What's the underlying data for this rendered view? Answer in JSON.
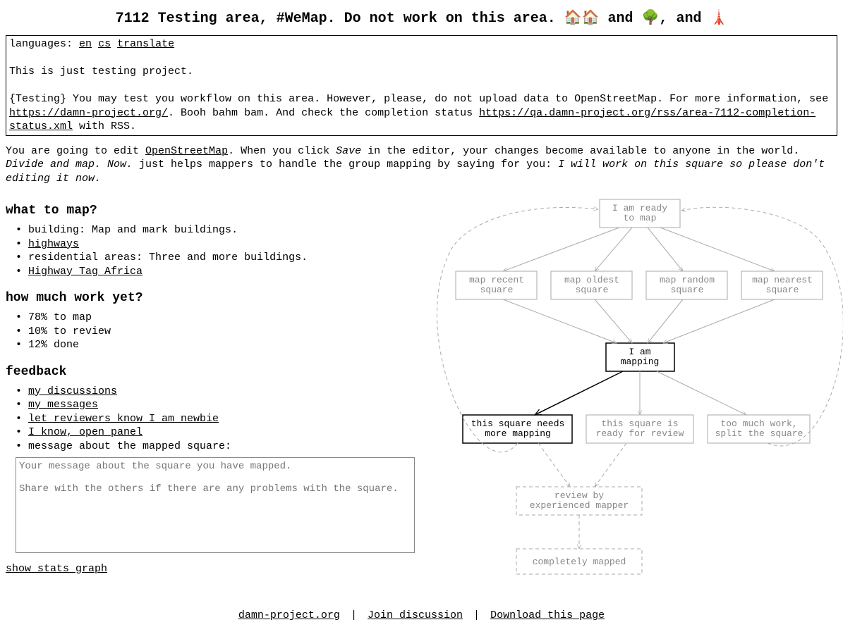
{
  "title": "7112 Testing area, #WeMap. Do not work on this area. 🏠🏠 and 🌳, and 🗼",
  "languages_label": "languages:",
  "languages": {
    "en": "en",
    "cs": "cs",
    "translate": "translate"
  },
  "desc": {
    "intro": "This is just testing project.",
    "body1a": "{Testing} You may test you workflow on this area. However, please, do not upload data to OpenStreetMap. For more information, see ",
    "link1": "https://damn-project.org/",
    "body1b": ". Booh bahm bam. And check the completion status ",
    "link2": "https://qa.damn-project.org/rss/area-7112-completion-status.xml",
    "body1c": " with RSS."
  },
  "intro_para": {
    "a": "You are going to edit ",
    "osm": "OpenStreetMap",
    "b": ". When you click ",
    "save": "Save",
    "c": " in the editor, your changes become available to anyone in the world. ",
    "slogan": "Divide and map. Now.",
    "d": " just helps mappers to handle the group mapping by saying for you: ",
    "promise": "I will work on this square so please don't editing it now."
  },
  "what_to_map_heading": "what to map?",
  "what_to_map": {
    "building": "building: Map and mark buildings.",
    "highways": "highways",
    "residential": "residential areas: Three and more buildings.",
    "hta": "Highway Tag Africa"
  },
  "how_much_heading": "how much work yet?",
  "how_much": {
    "to_map": "78% to map",
    "to_review": "10% to review",
    "done": "12% done"
  },
  "feedback_heading": "feedback",
  "feedback": {
    "my_discussions": "my discussions",
    "my_messages": "my messages",
    "newbie": "let reviewers know I am newbie",
    "open_panel": "I know, open panel",
    "msg_label": "message about the mapped square:"
  },
  "textarea_placeholder": "Your message about the square you have mapped.\n\nShare with the others if there are any problems with the square.",
  "show_stats": "show stats graph",
  "footer": {
    "site": "damn-project.org",
    "join": "Join discussion",
    "download": "Download this page"
  },
  "diagram": {
    "ready": {
      "l1": "I am ready",
      "l2": "to map"
    },
    "recent": {
      "l1": "map recent",
      "l2": "square"
    },
    "oldest": {
      "l1": "map oldest",
      "l2": "square"
    },
    "random": {
      "l1": "map random",
      "l2": "square"
    },
    "nearest": {
      "l1": "map nearest",
      "l2": "square"
    },
    "mapping": {
      "l1": "I am",
      "l2": "mapping"
    },
    "needs_more": {
      "l1": "this square needs",
      "l2": "more mapping"
    },
    "ready_review": {
      "l1": "this square is",
      "l2": "ready for review"
    },
    "too_much": {
      "l1": "too much work,",
      "l2": "split the square"
    },
    "review": {
      "l1": "review by",
      "l2": "experienced mapper"
    },
    "completed": "completely mapped"
  }
}
